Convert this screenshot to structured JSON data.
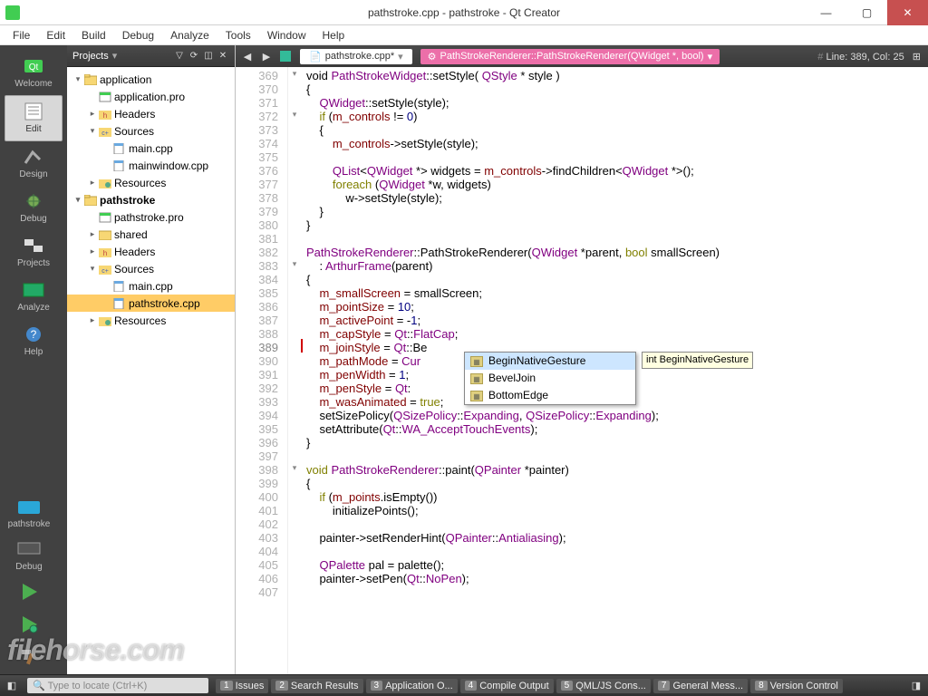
{
  "window": {
    "title": "pathstroke.cpp - pathstroke - Qt Creator"
  },
  "menubar": [
    "File",
    "Edit",
    "Build",
    "Debug",
    "Analyze",
    "Tools",
    "Window",
    "Help"
  ],
  "leftrail": {
    "items": [
      {
        "label": "Welcome"
      },
      {
        "label": "Edit"
      },
      {
        "label": "Design"
      },
      {
        "label": "Debug"
      },
      {
        "label": "Projects"
      },
      {
        "label": "Analyze"
      },
      {
        "label": "Help"
      }
    ],
    "bottom": {
      "project": "pathstroke",
      "kit": "",
      "config": "Debug"
    }
  },
  "projpanel": {
    "header": "Projects",
    "tree": [
      {
        "d": 0,
        "tw": "▾",
        "ic": "proj",
        "t": "application",
        "bold": false
      },
      {
        "d": 1,
        "tw": "",
        "ic": "pro",
        "t": "application.pro"
      },
      {
        "d": 1,
        "tw": "▸",
        "ic": "hdr",
        "t": "Headers"
      },
      {
        "d": 1,
        "tw": "▾",
        "ic": "src",
        "t": "Sources"
      },
      {
        "d": 2,
        "tw": "",
        "ic": "cpp",
        "t": "main.cpp"
      },
      {
        "d": 2,
        "tw": "",
        "ic": "cpp",
        "t": "mainwindow.cpp"
      },
      {
        "d": 1,
        "tw": "▸",
        "ic": "res",
        "t": "Resources"
      },
      {
        "d": 0,
        "tw": "▾",
        "ic": "proj",
        "t": "pathstroke",
        "bold": true
      },
      {
        "d": 1,
        "tw": "",
        "ic": "pro",
        "t": "pathstroke.pro"
      },
      {
        "d": 1,
        "tw": "▸",
        "ic": "shr",
        "t": "shared"
      },
      {
        "d": 1,
        "tw": "▸",
        "ic": "hdr",
        "t": "Headers"
      },
      {
        "d": 1,
        "tw": "▾",
        "ic": "src",
        "t": "Sources"
      },
      {
        "d": 2,
        "tw": "",
        "ic": "cpp",
        "t": "main.cpp"
      },
      {
        "d": 2,
        "tw": "",
        "ic": "cpp",
        "t": "pathstroke.cpp",
        "sel": true
      },
      {
        "d": 1,
        "tw": "▸",
        "ic": "res",
        "t": "Resources"
      }
    ]
  },
  "editor": {
    "tab": "pathstroke.cpp*",
    "crumb": "PathStrokeRenderer::PathStrokeRenderer(QWidget *, bool)",
    "pos": "Line: 389, Col: 25",
    "first_line": 369,
    "lines": [
      {
        "h": "void <TY>PathStrokeWidget</TY>::<FN>setStyle</FN>( <TY>QStyle</TY> * style )",
        "f": "▾"
      },
      {
        "h": "{"
      },
      {
        "h": "    <TY>QWidget</TY>::<FN>setStyle</FN>(style);"
      },
      {
        "h": "    <KW>if</KW> (<MV>m_controls</MV> != <NM>0</NM>)",
        "f": "▾"
      },
      {
        "h": "    {"
      },
      {
        "h": "        <MV>m_controls</MV>-><FN>setStyle</FN>(style);"
      },
      {
        "h": ""
      },
      {
        "h": "        <TY>QList</TY>&lt;<TY>QWidget</TY> *&gt; widgets = <MV>m_controls</MV>-><FN>findChildren</FN>&lt;<TY>QWidget</TY> *&gt;();"
      },
      {
        "h": "        <KW>foreach</KW> (<TY>QWidget</TY> *w, widgets)"
      },
      {
        "h": "            w-><FN>setStyle</FN>(style);"
      },
      {
        "h": "    }"
      },
      {
        "h": "}"
      },
      {
        "h": ""
      },
      {
        "h": "<TY>PathStrokeRenderer</TY>::<FN>PathStrokeRenderer</FN>(<TY>QWidget</TY> *parent, <KW>bool</KW> smallScreen)"
      },
      {
        "h": "    : <TY>ArthurFrame</TY>(parent)",
        "f": "▾"
      },
      {
        "h": "{"
      },
      {
        "h": "    <MV>m_smallScreen</MV> = smallScreen;"
      },
      {
        "h": "    <MV>m_pointSize</MV> = <NM>10</NM>;"
      },
      {
        "h": "    <MV>m_activePoint</MV> = -<NM>1</NM>;"
      },
      {
        "h": "    <MV>m_capStyle</MV> = <TY>Qt</TY>::<TY>FlatCap</TY>;"
      },
      {
        "h": "    <MV>m_joinStyle</MV> = <TY>Qt</TY>::Be"
      },
      {
        "h": "    <MV>m_pathMode</MV> = <TY>Cur</TY>"
      },
      {
        "h": "    <MV>m_penWidth</MV> = <NM>1</NM>;"
      },
      {
        "h": "    <MV>m_penStyle</MV> = <TY>Qt</TY>:"
      },
      {
        "h": "    <MV>m_wasAnimated</MV> = <KW>true</KW>;"
      },
      {
        "h": "    <FN>setSizePolicy</FN>(<TY>QSizePolicy</TY>::<TY>Expanding</TY>, <TY>QSizePolicy</TY>::<TY>Expanding</TY>);"
      },
      {
        "h": "    <FN>setAttribute</FN>(<TY>Qt</TY>::<TY>WA_AcceptTouchEvents</TY>);"
      },
      {
        "h": "}"
      },
      {
        "h": ""
      },
      {
        "h": "<KW>void</KW> <TY>PathStrokeRenderer</TY>::<FN>paint</FN>(<TY>QPainter</TY> *painter)",
        "f": "▾"
      },
      {
        "h": "{"
      },
      {
        "h": "    <KW>if</KW> (<MV>m_points</MV>.<FN>isEmpty</FN>())"
      },
      {
        "h": "        <FN>initializePoints</FN>();"
      },
      {
        "h": ""
      },
      {
        "h": "    painter-><FN>setRenderHint</FN>(<TY>QPainter</TY>::<TY>Antialiasing</TY>);"
      },
      {
        "h": ""
      },
      {
        "h": "    <TY>QPalette</TY> pal = <FN>palette</FN>();"
      },
      {
        "h": "    painter-><FN>setPen</FN>(<TY>Qt</TY>::<TY>NoPen</TY>);"
      },
      {
        "h": ""
      }
    ],
    "completion": {
      "items": [
        {
          "t": "BeginNativeGesture",
          "sel": true
        },
        {
          "t": "BevelJoin"
        },
        {
          "t": "BottomEdge"
        }
      ],
      "tooltip": "int BeginNativeGesture"
    }
  },
  "locate_placeholder": "Type to locate (Ctrl+K)",
  "bottombar": [
    {
      "n": "1",
      "t": "Issues"
    },
    {
      "n": "2",
      "t": "Search Results"
    },
    {
      "n": "3",
      "t": "Application O..."
    },
    {
      "n": "4",
      "t": "Compile Output"
    },
    {
      "n": "5",
      "t": "QML/JS Cons..."
    },
    {
      "n": "7",
      "t": "General Mess..."
    },
    {
      "n": "8",
      "t": "Version Control"
    }
  ],
  "watermark": "filehorse.com"
}
